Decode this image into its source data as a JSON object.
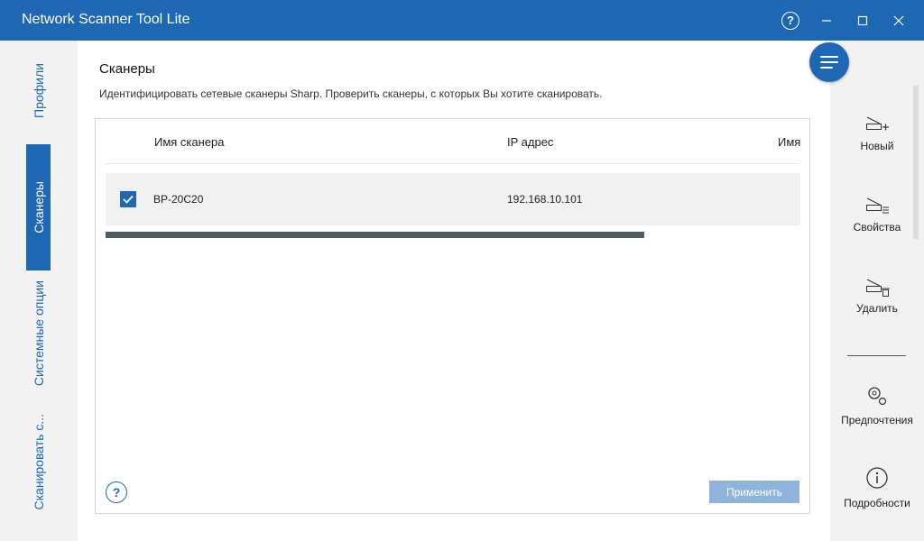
{
  "window": {
    "title": "Network Scanner Tool Lite",
    "help_glyph": "?",
    "minimize_glyph": "–",
    "maximize_glyph": "□",
    "close_glyph": "✕"
  },
  "nav": {
    "tabs": [
      {
        "label": "Профили",
        "active": false
      },
      {
        "label": "Сканеры",
        "active": true
      },
      {
        "label": "Системные опции",
        "active": false
      },
      {
        "label": "Сканировать с...",
        "active": false
      }
    ]
  },
  "page": {
    "title": "Сканеры",
    "description": "Идентифицировать сетевые сканеры Sharp. Проверить сканеры, с которых Вы хотите сканировать."
  },
  "table": {
    "columns": [
      "Имя сканера",
      "IP адрес",
      "Имя"
    ],
    "rows": [
      {
        "checked": true,
        "name": "BP-20C20",
        "ip": "192.168.10.101"
      }
    ]
  },
  "footer": {
    "help_glyph": "?",
    "apply_label": "Применить"
  },
  "actions": {
    "new": "Новый",
    "properties": "Свойства",
    "delete": "Удалить",
    "preferences": "Предпочтения",
    "details": "Подробности"
  },
  "colors": {
    "accent": "#1e68b3",
    "disabled_button": "#8fb3da",
    "row_highlight": "#f0f0f0"
  }
}
